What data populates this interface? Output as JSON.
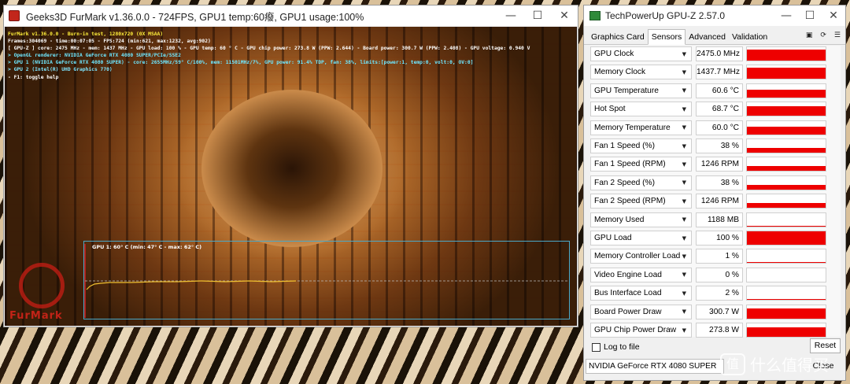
{
  "furmark": {
    "title": "Geeks3D FurMark v1.36.0.0 - 724FPS, GPU1 temp:60癈, GPU1 usage:100%",
    "window_buttons": {
      "minimize": "—",
      "maximize": "☐",
      "close": "✕"
    },
    "overlay_lines": [
      {
        "text": "FurMark v1.36.0.0 - Burn-in test, 1280x720 (0X MSAA)",
        "color": "y"
      },
      {
        "text": "Frames:304069 - time:00:07:05 - FPS:724 (min:621, max:1232, avg:902)",
        "color": "w"
      },
      {
        "text": "[ GPU-Z ] core: 2475 MHz - mem: 1437 MHz - GPU load: 100 % - GPU temp: 60 ° C - GPU chip power: 273.8 W (PPW: 2.644) - Board power: 300.7 W (PPW: 2.408) - GPU voltage: 0.940 V",
        "color": "w"
      },
      {
        "text": "> OpenGL renderer: NVIDIA GeForce RTX 4080 SUPER/PCIe/SSE2",
        "color": "c"
      },
      {
        "text": "> GPU 1 (NVIDIA GeForce RTX 4080 SUPER) - core: 2655MHz/59° C/100%, mem: 11501MHz/7%, GPU power: 91.4% TDP, fan: 38%, limits:[power:1, temp:0, volt:0, OV:0]",
        "color": "c"
      },
      {
        "text": "> GPU 2 (Intel(R) UHD Graphics 770)",
        "color": "g"
      },
      {
        "text": "- F1: toggle help",
        "color": "w"
      }
    ],
    "graph_label": "GPU 1: 60° C (min: 47° C - max: 62° C)",
    "logo_text": "FurMark"
  },
  "gpuz": {
    "title": "TechPowerUp GPU-Z 2.57.0",
    "window_buttons": {
      "minimize": "—",
      "maximize": "☐",
      "close": "✕"
    },
    "tabs": [
      "Graphics Card",
      "Sensors",
      "Advanced",
      "Validation"
    ],
    "active_tab": "Sensors",
    "tool_icons": [
      "camera-icon",
      "refresh-icon",
      "menu-icon"
    ],
    "sensors": [
      {
        "name": "GPU Clock",
        "value": "2475.0 MHz",
        "level": 0.85
      },
      {
        "name": "Memory Clock",
        "value": "1437.7 MHz",
        "level": 0.85
      },
      {
        "name": "GPU Temperature",
        "value": "60.6 °C",
        "level": 0.6
      },
      {
        "name": "Hot Spot",
        "value": "68.7 °C",
        "level": 0.68
      },
      {
        "name": "Memory Temperature",
        "value": "60.0 °C",
        "level": 0.6
      },
      {
        "name": "Fan 1 Speed (%)",
        "value": "38 %",
        "level": 0.38
      },
      {
        "name": "Fan 1 Speed (RPM)",
        "value": "1246 RPM",
        "level": 0.38
      },
      {
        "name": "Fan 2 Speed (%)",
        "value": "38 %",
        "level": 0.38
      },
      {
        "name": "Fan 2 Speed (RPM)",
        "value": "1246 RPM",
        "level": 0.38
      },
      {
        "name": "Memory Used",
        "value": "1188 MB",
        "level": 0.07
      },
      {
        "name": "GPU Load",
        "value": "100 %",
        "level": 1.0
      },
      {
        "name": "Memory Controller Load",
        "value": "1 %",
        "level": 0.01
      },
      {
        "name": "Video Engine Load",
        "value": "0 %",
        "level": 0.0
      },
      {
        "name": "Bus Interface Load",
        "value": "2 %",
        "level": 0.02
      },
      {
        "name": "Board Power Draw",
        "value": "300.7 W",
        "level": 0.75
      },
      {
        "name": "GPU Chip Power Draw",
        "value": "273.8 W",
        "level": 0.7
      }
    ],
    "log_label": "Log to file",
    "reset_label": "Reset",
    "gpu_select": "NVIDIA GeForce RTX 4080 SUPER",
    "close_label": "Close",
    "bar_color": "#ee0000"
  },
  "watermark": {
    "badge": "值",
    "text": "什么值得买"
  }
}
